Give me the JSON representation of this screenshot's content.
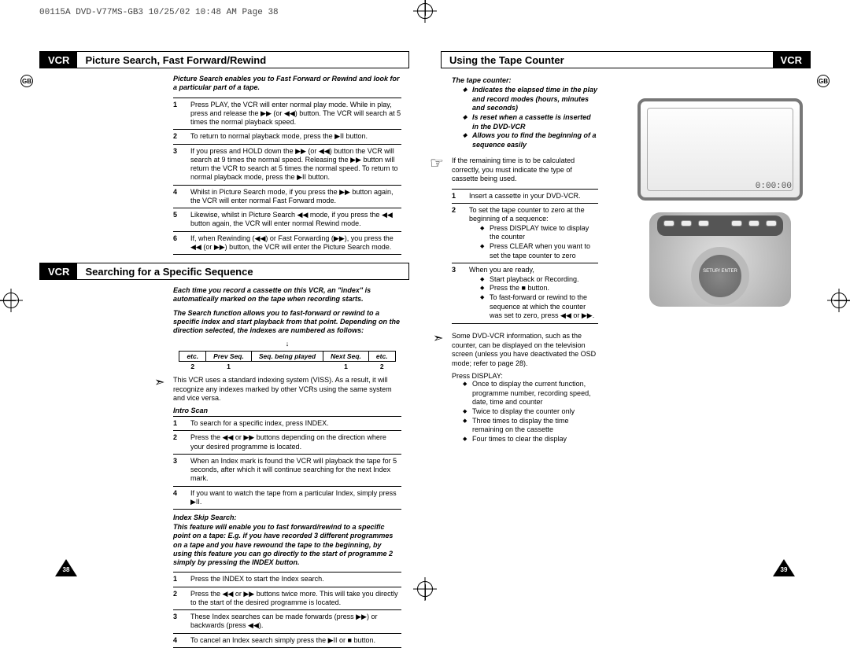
{
  "header_line": "00115A DVD-V77MS-GB3  10/25/02 10:48 AM  Page 38",
  "gb_label": "GB",
  "page_numbers": {
    "left": "38",
    "right": "39"
  },
  "glyphs": {
    "ff": "▶▶",
    "rw": "◀◀",
    "play": "▶",
    "pause": "▶II",
    "stop": "■",
    "skipf": "▶▶I",
    "skipb": "I◀◀"
  },
  "left": {
    "section1": {
      "tag": "VCR",
      "title": "Picture Search, Fast Forward/Rewind",
      "intro": "Picture Search enables you to Fast Forward or Rewind and look for a particular part of a tape.",
      "rows": [
        "Press PLAY, the VCR will enter normal play mode. While in play, press and release the ▶▶ (or ◀◀) button. The VCR will search at 5 times the normal playback speed.",
        "To return to normal playback mode, press the ▶II button.",
        "If you press and HOLD down the ▶▶ (or ◀◀) button the VCR will search at 9 times the normal speed. Releasing the ▶▶ button will return the VCR to search at 5 times the normal speed. To return to normal playback mode, press the ▶II button.",
        "Whilst in Picture Search mode, if you press the ▶▶ button again, the VCR will enter normal Fast Forward mode.",
        "Likewise, whilst in Picture Search ◀◀ mode, if you press the ◀◀ button again, the VCR will enter normal Rewind mode.",
        "If, when Rewinding (◀◀) or Fast Forwarding (▶▶), you press the ◀◀ (or ▶▶) button, the VCR will enter the Picture Search mode."
      ]
    },
    "section2": {
      "tag": "VCR",
      "title": "Searching for a Specific Sequence",
      "intro1": "Each time you record a cassette on this VCR, an \"index\" is automatically marked on the tape when recording starts.",
      "intro2": "The Search function allows you to fast-forward or rewind to a specific index and start playback from that point. Depending on the direction selected, the indexes are numbered as follows:",
      "table": {
        "headers": [
          "etc.",
          "Prev Seq.",
          "Seq. being played",
          "Next Seq.",
          "etc."
        ],
        "nums": [
          "2",
          "1",
          "",
          "1",
          "2"
        ]
      },
      "viss_note": "This VCR uses a standard indexing system (VISS). As a result, it will recognize any indexes marked by other VCRs using the same system and vice versa.",
      "intro_scan": "Intro Scan",
      "scan_rows": [
        "To search for a specific index, press INDEX.",
        "Press the ◀◀ or ▶▶ buttons depending on the direction where your desired programme is located.",
        "When an Index mark is found the VCR will playback the tape for 5 seconds, after which it will continue searching for the next Index mark.",
        "If you want to watch the tape from a particular Index, simply press ▶II."
      ],
      "skip_head": "Index Skip Search:",
      "skip_intro": "This feature will enable you to fast forward/rewind to a specific point on a tape: E.g. if you have recorded 3 different programmes on a tape and you have rewound the tape to the beginning, by using this feature you can go directly to the start of programme 2 simply by pressing the INDEX button.",
      "skip_rows": [
        "Press the INDEX to start the Index search.",
        "Press the ◀◀ or ▶▶ buttons twice more. This will take you directly to the start of the desired programme is located.",
        "These Index searches can be made forwards (press ▶▶) or backwards (press ◀◀).",
        "To cancel an Index search simply press the ▶II or ■ button."
      ]
    }
  },
  "right": {
    "section3": {
      "tag": "VCR",
      "title": "Using the Tape Counter",
      "tc_head": "The tape counter:",
      "tc_bullets": [
        "Indicates the elapsed time in the play and record modes (hours, minutes and seconds)",
        "Is reset when a cassette is inserted in the DVD-VCR",
        "Allows you to find the beginning of a sequence easily"
      ],
      "hand_note": "If the remaining time is to be calculated correctly, you must indicate the type of cassette being used.",
      "rows": [
        {
          "n": "1",
          "t": "Insert a cassette in your DVD-VCR."
        },
        {
          "n": "2",
          "t": "To set the tape counter to zero at the beginning of a sequence:",
          "b": [
            "Press DISPLAY twice to display the counter",
            "Press CLEAR when you want to set the tape counter to zero"
          ]
        },
        {
          "n": "3",
          "t": "When you are ready,",
          "b": [
            "Start playback or Recording.",
            "Press the ■ button.",
            "To fast-forward or rewind to the sequence at which the counter was set to zero, press ◀◀ or ▶▶."
          ]
        }
      ],
      "osd_note": "Some DVD-VCR information, such as the counter, can be displayed on the television screen (unless you have deactivated the OSD mode; refer to page 28).",
      "press_display": "Press DISPLAY:",
      "display_bullets": [
        "Once to display the current function, programme number, recording speed, date, time and counter",
        "Twice to display the counter only",
        "Three times to display the time remaining on the cassette",
        "Four times to clear the display"
      ],
      "screen_time": "0:00:00",
      "remote_enter": "SETUP/\nENTER",
      "arrow": "↓"
    }
  }
}
